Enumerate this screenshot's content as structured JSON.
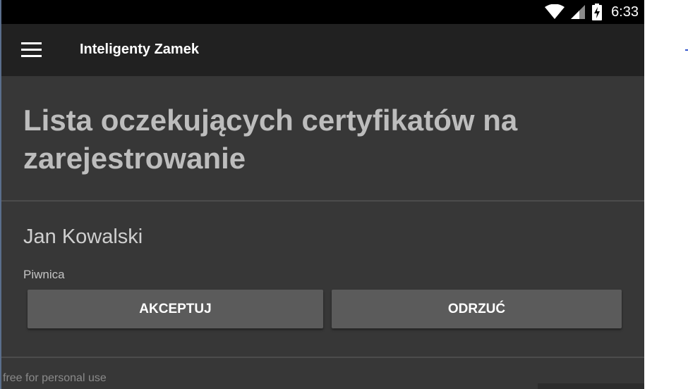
{
  "status_bar": {
    "time": "6:33",
    "icons": [
      "wifi-icon",
      "cell-signal-icon",
      "battery-charging-icon"
    ]
  },
  "app_bar": {
    "title": "Inteligenty Zamek",
    "menu_icon": "hamburger-menu-icon"
  },
  "page": {
    "title": "Lista oczekujących certyfikatów na zarejestrowanie"
  },
  "pending_item": {
    "name": "Jan Kowalski",
    "location": "Piwnica",
    "accept_label": "AKCEPTUJ",
    "reject_label": "ODRZUĆ"
  },
  "watermark": "free for personal use",
  "colors": {
    "background": "#373737",
    "app_bar": "#212121",
    "status_bar": "#000000",
    "button": "#5b5b5b",
    "title_text": "#bdbdbd"
  }
}
